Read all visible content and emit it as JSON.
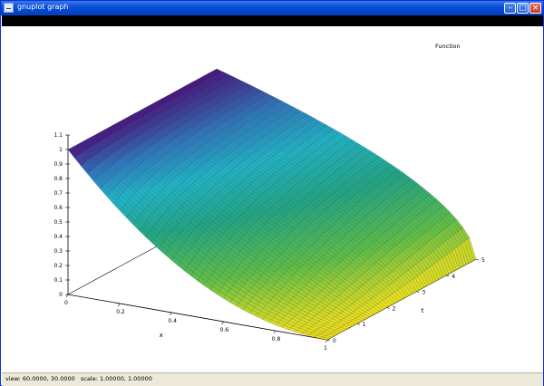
{
  "window": {
    "title": "gnuplot graph",
    "minimize_icon": "minimize-icon",
    "maximize_icon": "maximize-icon",
    "close_icon": "close-icon"
  },
  "status": {
    "text": "view: 60.0000, 30.0000   scale: 1.00000, 1.00000"
  },
  "chart_data": {
    "type": "surface",
    "title": "",
    "legend": {
      "entries": [
        "Function"
      ],
      "placement": "top-right"
    },
    "xlabel": "x",
    "ylabel": "t",
    "zlabel": "",
    "xlim": [
      0,
      1
    ],
    "ylim": [
      0,
      5
    ],
    "zlim": [
      0,
      1.1
    ],
    "x_ticks": [
      "0",
      "0.2",
      "0.4",
      "0.6",
      "0.8",
      "1"
    ],
    "t_ticks": [
      "0",
      "1",
      "2",
      "3",
      "4",
      "5"
    ],
    "z_ticks": [
      "0",
      "0.1",
      "0.2",
      "0.3",
      "0.4",
      "0.5",
      "0.6",
      "0.7",
      "0.8",
      "0.9",
      "1",
      "1.1"
    ],
    "view": {
      "rot_x": 60,
      "rot_z": 30
    },
    "surface_samples": {
      "x": [
        0,
        0.2,
        0.4,
        0.6,
        0.8,
        1
      ],
      "t": [
        0,
        0.5,
        1,
        2,
        3,
        4,
        5
      ],
      "z": [
        [
          1,
          0.64,
          0.36,
          0.16,
          0.04,
          0
        ],
        [
          1,
          0.78,
          0.58,
          0.4,
          0.22,
          0
        ],
        [
          1,
          0.84,
          0.68,
          0.52,
          0.34,
          0
        ],
        [
          1,
          0.9,
          0.78,
          0.65,
          0.5,
          0
        ],
        [
          1,
          0.93,
          0.84,
          0.72,
          0.58,
          0
        ],
        [
          1,
          0.95,
          0.87,
          0.77,
          0.62,
          0
        ],
        [
          1,
          0.96,
          0.89,
          0.8,
          0.65,
          0
        ]
      ]
    },
    "colors": {
      "low": "#f0e21d",
      "mid": "#21a583",
      "cyan": "#1fc4d6",
      "high": "#46137f"
    }
  }
}
